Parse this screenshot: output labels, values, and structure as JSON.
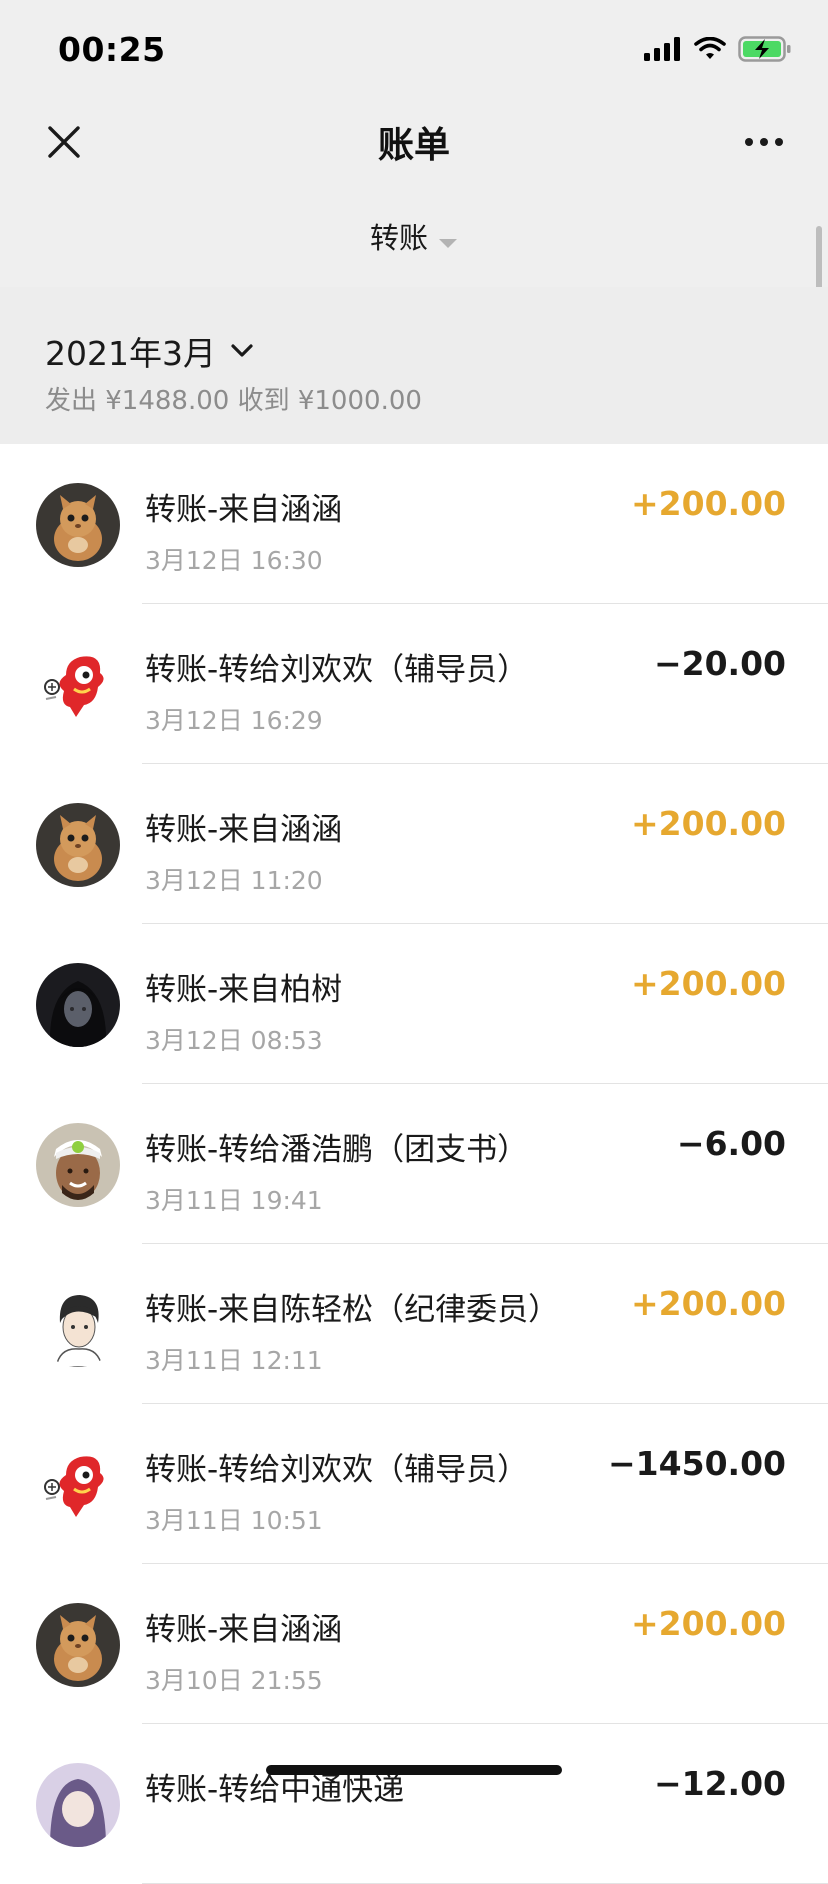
{
  "status_bar": {
    "time": "00:25"
  },
  "nav": {
    "title": "账单"
  },
  "filter": {
    "label": "转账"
  },
  "month": {
    "title": "2021年3月",
    "summary": "发出 ¥1488.00 收到 ¥1000.00"
  },
  "colors": {
    "income": "#e6a82f",
    "expense": "#1a1a1a",
    "header_bg": "#efefef"
  },
  "transactions": [
    {
      "title": "转账-来自涵涵",
      "time": "3月12日 16:30",
      "amount": "+200.00",
      "avatar": "cat-avatar-icon"
    },
    {
      "title": "转账-转给刘欢欢（辅导员）",
      "time": "3月12日 16:29",
      "amount": "−20.00",
      "avatar": "mascot-avatar-icon"
    },
    {
      "title": "转账-来自涵涵",
      "time": "3月12日 11:20",
      "amount": "+200.00",
      "avatar": "cat-avatar-icon"
    },
    {
      "title": "转账-来自柏树",
      "time": "3月12日 08:53",
      "amount": "+200.00",
      "avatar": "dark-portrait-avatar-icon"
    },
    {
      "title": "转账-转给潘浩鹏（团支书）",
      "time": "3月11日 19:41",
      "amount": "−6.00",
      "avatar": "player-avatar-icon"
    },
    {
      "title": "转账-来自陈轻松（纪律委员）",
      "time": "3月11日 12:11",
      "amount": "+200.00",
      "avatar": "sketch-portrait-avatar-icon"
    },
    {
      "title": "转账-转给刘欢欢（辅导员）",
      "time": "3月11日 10:51",
      "amount": "−1450.00",
      "avatar": "mascot-avatar-icon"
    },
    {
      "title": "转账-来自涵涵",
      "time": "3月10日 21:55",
      "amount": "+200.00",
      "avatar": "cat-avatar-icon"
    },
    {
      "title": "转账-转给中通快递",
      "time": "",
      "amount": "−12.00",
      "avatar": "anime-avatar-icon"
    }
  ]
}
